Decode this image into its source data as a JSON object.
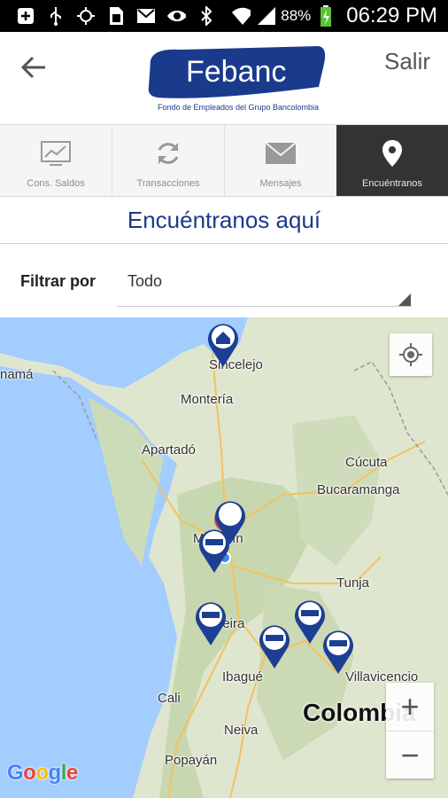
{
  "status_bar": {
    "battery": "88%",
    "time": "06:29 PM",
    "icons": [
      "add-box-icon",
      "usb-icon",
      "gps-icon",
      "sim-icon",
      "gmail-icon",
      "eye-icon",
      "bluetooth-icon",
      "wifi-icon",
      "signal-icon",
      "battery-charging-icon"
    ]
  },
  "app_bar": {
    "logo_text": "Febanc",
    "logo_subtitle": "Fondo de Empleados del Grupo Bancolombia",
    "logout_label": "Salir",
    "back_icon": "arrow-back-icon"
  },
  "tabs": [
    {
      "label": "Cons. Saldos",
      "icon": "chart-monitor-icon",
      "active": false
    },
    {
      "label": "Transacciones",
      "icon": "refresh-icon",
      "active": false
    },
    {
      "label": "Mensajes",
      "icon": "envelope-icon",
      "active": false
    },
    {
      "label": "Encuéntranos",
      "icon": "location-pin-icon",
      "active": true
    }
  ],
  "section": {
    "title": "Encuéntranos aquí"
  },
  "filter": {
    "label": "Filtrar por",
    "selected": "Todo"
  },
  "map": {
    "cities": [
      "Sincelejo",
      "Montería",
      "Apartadó",
      "Cúcuta",
      "Bucaramanga",
      "Medellín",
      "Tunja",
      "Pereira",
      "Ibagué",
      "Villavicencio",
      "Cali",
      "Neiva",
      "Popayán",
      "namá"
    ],
    "country_label": "Colombia",
    "attribution": "Google",
    "zoom_in": "+",
    "zoom_out": "−"
  },
  "colors": {
    "brand_blue": "#1a3a8c",
    "tab_active_bg": "#333333",
    "pin_blue": "#1c3f94",
    "water": "#a3ccff"
  }
}
